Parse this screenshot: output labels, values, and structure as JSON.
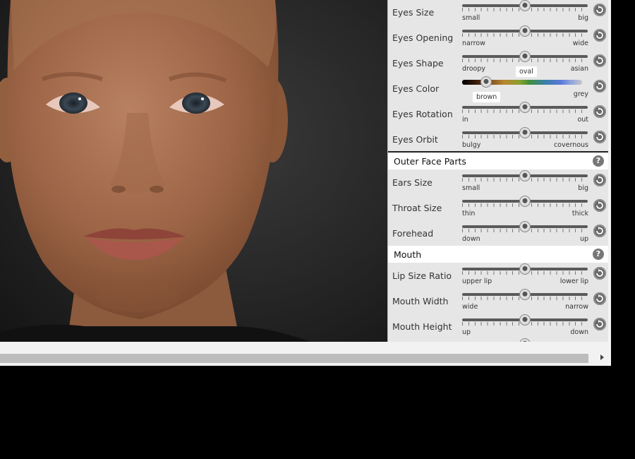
{
  "panel": {
    "rows_top": [
      {
        "label": "Eyes Size",
        "min": "small",
        "max": "big",
        "value": 0.5
      },
      {
        "label": "Eyes Opening",
        "min": "narrow",
        "max": "wide",
        "value": 0.5
      },
      {
        "label": "Eyes Shape",
        "min": "droopy",
        "max": "asian",
        "value": 0.5,
        "tooltip": "oval"
      },
      {
        "label": "Eyes Color",
        "min": "",
        "max": "grey",
        "value": 0.2,
        "tooltip": "brown"
      },
      {
        "label": "Eyes Rotation",
        "min": "in",
        "max": "out",
        "value": 0.5
      },
      {
        "label": "Eyes Orbit",
        "min": "bulgy",
        "max": "covernous",
        "value": 0.5
      }
    ],
    "section_outer": {
      "title": "Outer Face Parts",
      "help": "?"
    },
    "rows_outer": [
      {
        "label": "Ears Size",
        "min": "small",
        "max": "big",
        "value": 0.5
      },
      {
        "label": "Throat Size",
        "min": "thin",
        "max": "thick",
        "value": 0.5
      },
      {
        "label": "Forehead",
        "min": "down",
        "max": "up",
        "value": 0.5
      }
    ],
    "section_mouth": {
      "title": "Mouth",
      "help": "?"
    },
    "rows_mouth": [
      {
        "label": "Lip Size Ratio",
        "min": "upper lip",
        "max": "lower lip",
        "value": 0.5
      },
      {
        "label": "Mouth Width",
        "min": "wide",
        "max": "narrow",
        "value": 0.5
      },
      {
        "label": "Mouth Height",
        "min": "up",
        "max": "down",
        "value": 0.5
      }
    ]
  },
  "icons": {
    "reset": "reset-arrow-icon",
    "help": "help-icon",
    "scroll_right": "chevron-right-icon"
  },
  "colors": {
    "panel_bg": "#e6e6e6",
    "section_bg": "#ffffff",
    "skin": "#a86e4c"
  }
}
